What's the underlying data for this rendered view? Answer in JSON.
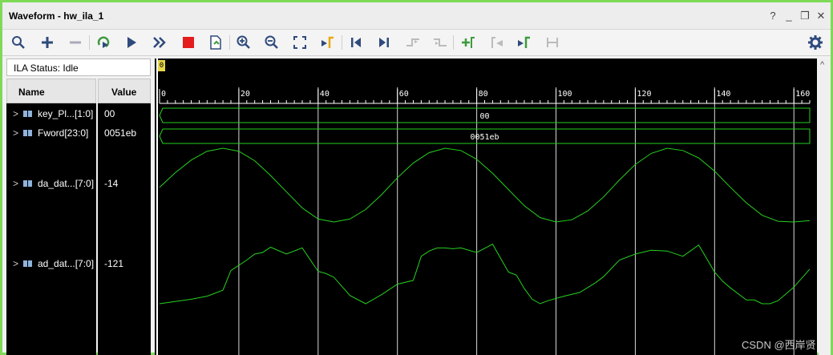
{
  "window": {
    "title": "Waveform - hw_ila_1",
    "buttons": [
      "?",
      "_",
      "❐",
      "✕"
    ]
  },
  "toolbar": {
    "icons": [
      "zoom-fit-search-icon",
      "add-icon",
      "remove-icon",
      "run-trigger-icon",
      "run-icon",
      "run-immediate-icon",
      "stop-icon",
      "export-icon",
      "zoom-in-icon",
      "zoom-out-icon",
      "zoom-full-icon",
      "go-to-cursor-icon",
      "go-to-start-icon",
      "go-to-end-icon",
      "previous-transition-icon",
      "next-transition-icon",
      "add-marker-icon",
      "previous-marker-icon",
      "next-marker-icon",
      "swap-cursors-icon",
      "settings-icon"
    ]
  },
  "ila_status": "ILA Status:  Idle",
  "columns": {
    "name": "Name",
    "value": "Value"
  },
  "signals": [
    {
      "name": "key_Pl...[1:0]",
      "value": "00",
      "kind": "bus",
      "bus_text": "00"
    },
    {
      "name": "Fword[23:0]",
      "value": "0051eb",
      "kind": "bus",
      "bus_text": "0051eb"
    },
    {
      "name": "da_dat...[7:0]",
      "value": "-14",
      "kind": "analog"
    },
    {
      "name": "ad_dat...[7:0]",
      "value": "-121",
      "kind": "analog"
    }
  ],
  "timeline": {
    "marker_label": "0",
    "start": 0,
    "end": 164,
    "major_step": 20,
    "tick_labels": [
      "0",
      "20",
      "40",
      "60",
      "80",
      "100",
      "120",
      "140",
      "160"
    ]
  },
  "da_wave": {
    "t": [
      0,
      4,
      8,
      12,
      16,
      20,
      24,
      28,
      32,
      36,
      40,
      44,
      48,
      52,
      56,
      60,
      64,
      68,
      72,
      76,
      80,
      84,
      88,
      92,
      96,
      100,
      104,
      108,
      112,
      116,
      120,
      124,
      128,
      132,
      136,
      140,
      144,
      148,
      152,
      156,
      160,
      164
    ],
    "level": [
      0.47,
      0.67,
      0.84,
      0.96,
      1.0,
      0.96,
      0.83,
      0.63,
      0.41,
      0.19,
      0.04,
      0.0,
      0.04,
      0.17,
      0.37,
      0.6,
      0.8,
      0.94,
      1.0,
      0.97,
      0.85,
      0.66,
      0.44,
      0.22,
      0.06,
      0.0,
      0.03,
      0.15,
      0.34,
      0.57,
      0.78,
      0.93,
      1.0,
      0.97,
      0.87,
      0.69,
      0.47,
      0.26,
      0.09,
      0.01,
      0.0,
      0.02
    ]
  },
  "ad_wave": {
    "t": [
      0,
      8,
      12,
      16,
      18,
      22,
      24,
      26,
      28,
      32,
      36,
      40,
      42,
      44,
      48,
      52,
      56,
      60,
      64,
      66,
      68,
      70,
      72,
      74,
      76,
      80,
      84,
      88,
      90,
      92,
      94,
      96,
      98,
      102,
      106,
      110,
      112,
      116,
      120,
      124,
      128,
      132,
      136,
      140,
      142,
      144,
      148,
      150,
      152,
      154,
      156,
      160,
      164
    ],
    "level": [
      0.0,
      0.06,
      0.1,
      0.18,
      0.44,
      0.58,
      0.66,
      0.68,
      0.75,
      0.66,
      0.74,
      0.43,
      0.4,
      0.35,
      0.11,
      0.0,
      0.12,
      0.26,
      0.31,
      0.63,
      0.7,
      0.74,
      0.74,
      0.73,
      0.74,
      0.68,
      0.79,
      0.42,
      0.38,
      0.2,
      0.06,
      0.0,
      0.04,
      0.1,
      0.15,
      0.28,
      0.36,
      0.58,
      0.66,
      0.71,
      0.7,
      0.63,
      0.78,
      0.42,
      0.3,
      0.21,
      0.05,
      0.05,
      0.0,
      0.0,
      0.04,
      0.22,
      0.46
    ]
  },
  "colors": {
    "accent_border": "#7ed957",
    "wave": "#26d11f",
    "grid": "#d8d8d8",
    "stop_red": "#e41c1c",
    "marker_yellow": "#e6d84a"
  },
  "watermark": "CSDN @西岸贤"
}
